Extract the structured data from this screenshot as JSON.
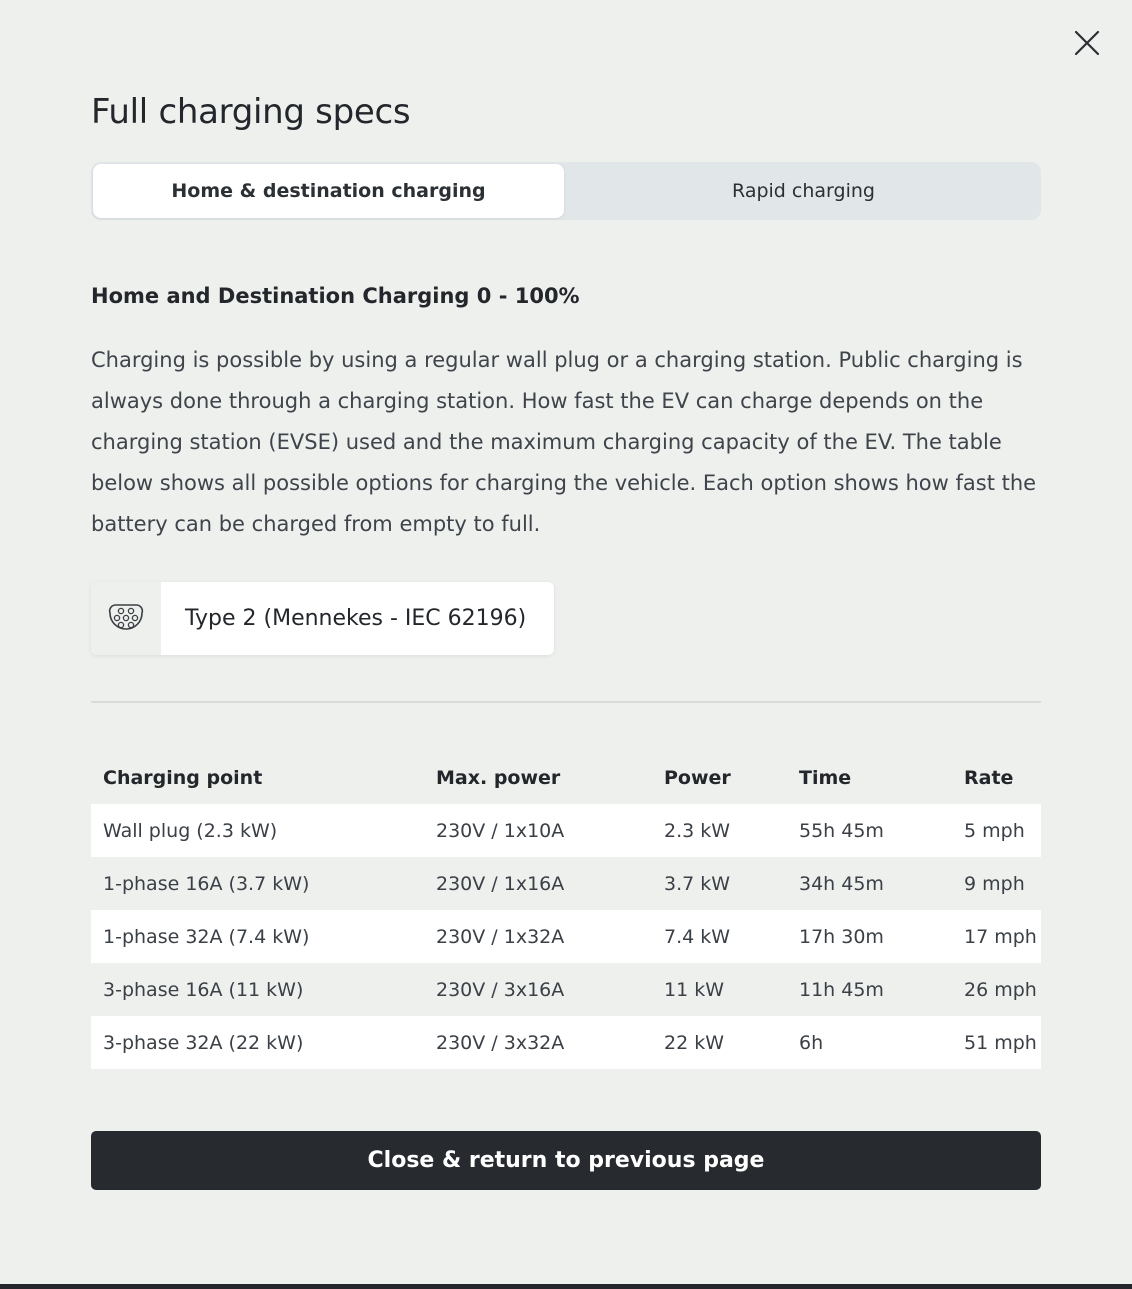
{
  "modal": {
    "title": "Full charging specs",
    "close_icon": "close-icon"
  },
  "tabs": [
    {
      "label": "Home & destination charging",
      "active": true
    },
    {
      "label": "Rapid charging",
      "active": false
    }
  ],
  "section": {
    "heading": "Home and Destination Charging 0 - 100%",
    "description": "Charging is possible by using a regular wall plug or a charging station. Public charging is always done through a charging station. How fast the EV can charge depends on the charging station (EVSE) used and the maximum charging capacity of the EV. The table below shows all possible options for charging the vehicle. Each option shows how fast the battery can be charged from empty to full."
  },
  "connector": {
    "icon": "type2-plug-icon",
    "label": "Type 2 (Mennekes - IEC 62196)"
  },
  "table": {
    "headers": [
      "Charging point",
      "Max. power",
      "Power",
      "Time",
      "Rate"
    ],
    "rows": [
      [
        "Wall plug (2.3 kW)",
        "230V / 1x10A",
        "2.3 kW",
        "55h 45m",
        "5 mph"
      ],
      [
        "1-phase 16A (3.7 kW)",
        "230V / 1x16A",
        "3.7 kW",
        "34h 45m",
        "9 mph"
      ],
      [
        "1-phase 32A (7.4 kW)",
        "230V / 1x32A",
        "7.4 kW",
        "17h 30m",
        "17 mph"
      ],
      [
        "3-phase 16A (11 kW)",
        "230V / 3x16A",
        "11 kW",
        "11h 45m",
        "26 mph"
      ],
      [
        "3-phase 32A (22 kW)",
        "230V / 3x32A",
        "22 kW",
        "6h",
        "51 mph"
      ]
    ]
  },
  "footer": {
    "close_button_label": "Close & return to previous page"
  },
  "colors": {
    "background": "#eef0ee",
    "tab_track": "#e1e6e8",
    "button_dark": "#272b30",
    "row_white": "#ffffff"
  }
}
